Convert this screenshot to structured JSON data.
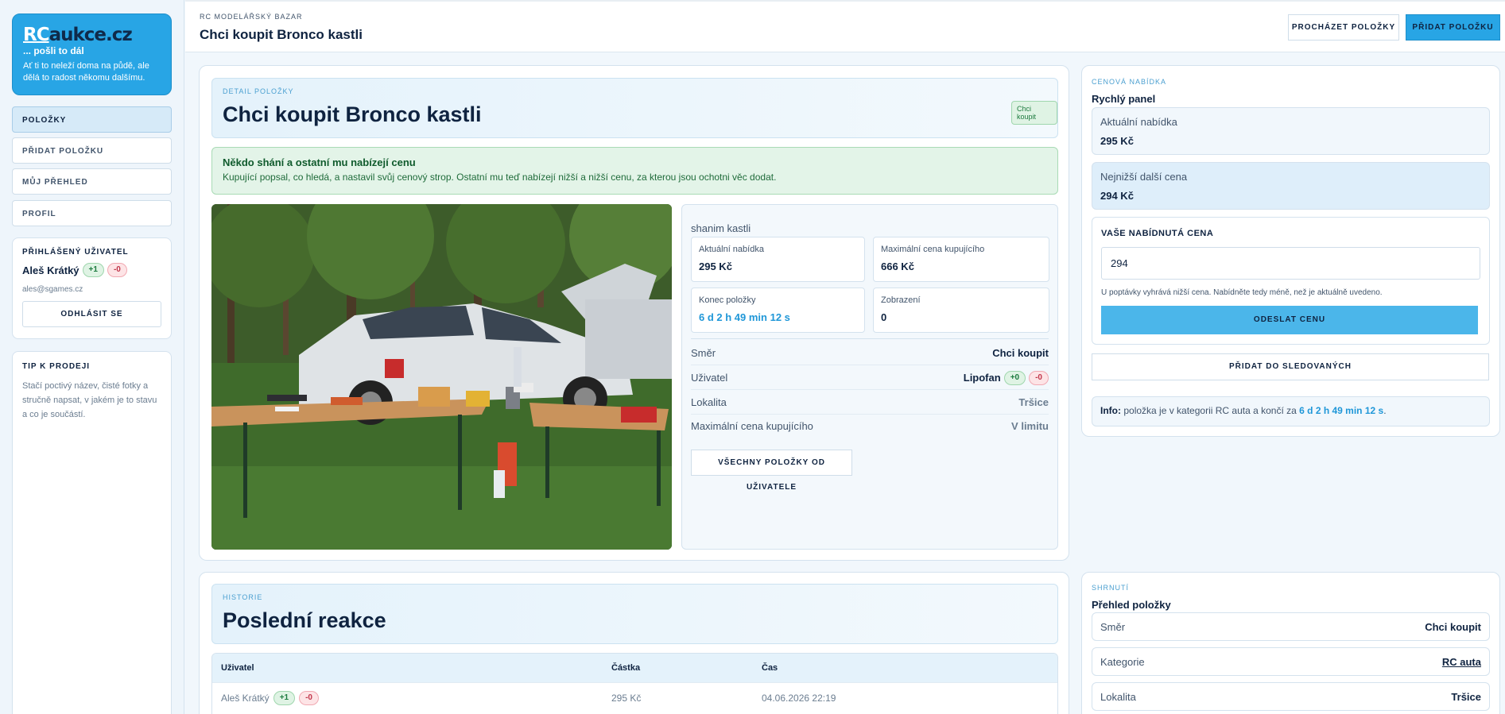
{
  "brand": {
    "logo_rc": "RC",
    "logo_rest": "aukce.cz",
    "tagline": "... pošli to dál",
    "description": "Ať ti to neleží doma na půdě, ale dělá to radost někomu dalšímu."
  },
  "nav": {
    "items": [
      {
        "label": "POLOŽKY",
        "active": true
      },
      {
        "label": "PŘIDAT POLOŽKU",
        "active": false
      },
      {
        "label": "MŮJ PŘEHLED",
        "active": false
      },
      {
        "label": "PROFIL",
        "active": false
      }
    ]
  },
  "user_card": {
    "heading": "PŘIHLÁŠENÝ UŽIVATEL",
    "name": "Aleš Krátký",
    "plus": "+1",
    "minus": "-0",
    "email": "ales@sgames.cz",
    "logout_label": "ODHLÁSIT SE"
  },
  "tip_card": {
    "heading": "TIP K PRODEJI",
    "text": "Stačí poctivý název, čisté fotky a stručně napsat, v jakém je to stavu a co je součástí."
  },
  "topbar": {
    "eyebrow": "RC MODELÁŘSKÝ BAZAR",
    "title": "Chci koupit Bronco kastli",
    "browse_label": "PROCHÁZET POLOŽKY",
    "add_label": "PŘIDAT POLOŽKU"
  },
  "detail": {
    "eyebrow": "DETAIL POLOŽKY",
    "title": "Chci koupit Bronco kastli",
    "badge": "Chci koupit",
    "alert_title": "Někdo shání a ostatní mu nabízejí cenu",
    "alert_text": "Kupující popsal, co hledá, a nastavil svůj cenový strop. Ostatní mu teď nabízejí nižší a nižší cenu, za kterou jsou ochotni věc dodat.",
    "description": "shanim kastli",
    "stats": [
      {
        "label": "Aktuální nabídka",
        "value": "295 Kč",
        "blue": false
      },
      {
        "label": "Maximální cena kupujícího",
        "value": "666 Kč",
        "blue": false
      },
      {
        "label": "Konec položky",
        "value": "6 d 2 h 49 min 12 s",
        "blue": true
      },
      {
        "label": "Zobrazení",
        "value": "0",
        "blue": false
      }
    ],
    "rows": [
      {
        "key": "Směr",
        "value": "Chci koupit"
      },
      {
        "key": "Uživatel",
        "value": "Lipofan",
        "plus": "+0",
        "minus": "-0"
      },
      {
        "key": "Lokalita",
        "value": "Tršice"
      },
      {
        "key": "Maximální cena kupujícího",
        "value": "V limitu"
      }
    ],
    "all_items_label": "VŠECHNY POLOŽKY OD UŽIVATELE"
  },
  "offer_panel": {
    "eyebrow": "CENOVÁ NABÍDKA",
    "title": "Rychlý panel",
    "current_label": "Aktuální nabídka",
    "current_value": "295 Kč",
    "next_label": "Nejnižší další cena",
    "next_value": "294 Kč",
    "your_price_label": "VAŠE NABÍDNUTÁ CENA",
    "your_price_value": "294",
    "hint": "U poptávky vyhrává nižší cena. Nabídněte tedy méně, než je aktuálně uvedeno.",
    "submit_label": "ODESLAT CENU",
    "watch_label": "PŘIDAT DO SLEDOVANÝCH",
    "info_prefix": "Info:",
    "info_text": "položka je v kategorii RC auta a končí za",
    "info_time": "6 d 2 h 49 min 12 s",
    "info_suffix": "."
  },
  "history": {
    "eyebrow": "HISTORIE",
    "title": "Poslední reakce",
    "columns": [
      "Uživatel",
      "Částka",
      "Čas"
    ],
    "rows": [
      {
        "user": "Aleš Krátký",
        "plus": "+1",
        "minus": "-0",
        "amount": "295 Kč",
        "time": "04.06.2026 22:19"
      }
    ]
  },
  "summary": {
    "eyebrow": "SHRNUTÍ",
    "title": "Přehled položky",
    "rows": [
      {
        "key": "Směr",
        "value": "Chci koupit"
      },
      {
        "key": "Kategorie",
        "value": "RC auta"
      },
      {
        "key": "Lokalita",
        "value": "Tršice"
      }
    ]
  },
  "colors": {
    "accent": "#28a5e5",
    "navy": "#0f2340",
    "success_bg": "#e3f4e8",
    "link": "#1f97d8"
  }
}
